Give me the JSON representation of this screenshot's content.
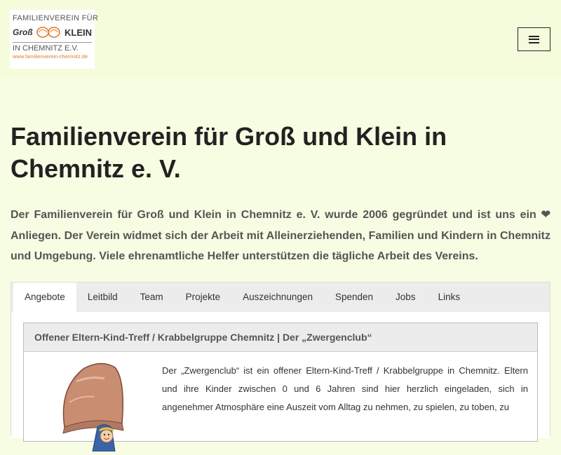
{
  "header": {
    "logo": {
      "line1": "FAMILIENVEREIN FÜR",
      "gross": "Groß",
      "klein": "KLEIN",
      "line3": "IN CHEMNITZ E.V.",
      "url": "www.familienverein-chemnitz.de"
    },
    "menu_icon": "hamburger-menu-icon"
  },
  "page": {
    "title": "Familienverein für Groß und Klein in Chemnitz e. V.",
    "intro": "Der Familienverein für Groß und Klein in Chemnitz e. V. wurde 2006 gegründet und ist uns ein ❤ Anliegen. Der Verein widmet sich der Arbeit mit Alleinerziehenden, Familien und Kindern in Chemnitz und Umgebung. Viele ehrenamtliche Helfer unterstützen die tägliche Arbeit des Vereins."
  },
  "tabs": [
    {
      "label": "Angebote",
      "active": true
    },
    {
      "label": "Leitbild",
      "active": false
    },
    {
      "label": "Team",
      "active": false
    },
    {
      "label": "Projekte",
      "active": false
    },
    {
      "label": "Auszeichnungen",
      "active": false
    },
    {
      "label": "Spenden",
      "active": false
    },
    {
      "label": "Jobs",
      "active": false
    },
    {
      "label": "Links",
      "active": false
    }
  ],
  "card": {
    "title": "Offener Eltern-Kind-Treff / Krabbelgruppe Chemnitz | Der „Zwergenclub“",
    "text": "Der „Zwergenclub“ ist ein offener Eltern-Kind-Treff / Krabbelgruppe in Chemnitz. Eltern und ihre Kinder zwischen 0 und 6 Jahren sind hier herzlich eingeladen, sich in angenehmer Atmosphäre eine Auszeit vom Alltag zu nehmen, zu spielen, zu toben, zu",
    "image_icon": "gnome-illustration"
  },
  "colors": {
    "background": "#f7fde3",
    "logo_accent": "#e07a2a",
    "tab_bg": "#ececec"
  }
}
